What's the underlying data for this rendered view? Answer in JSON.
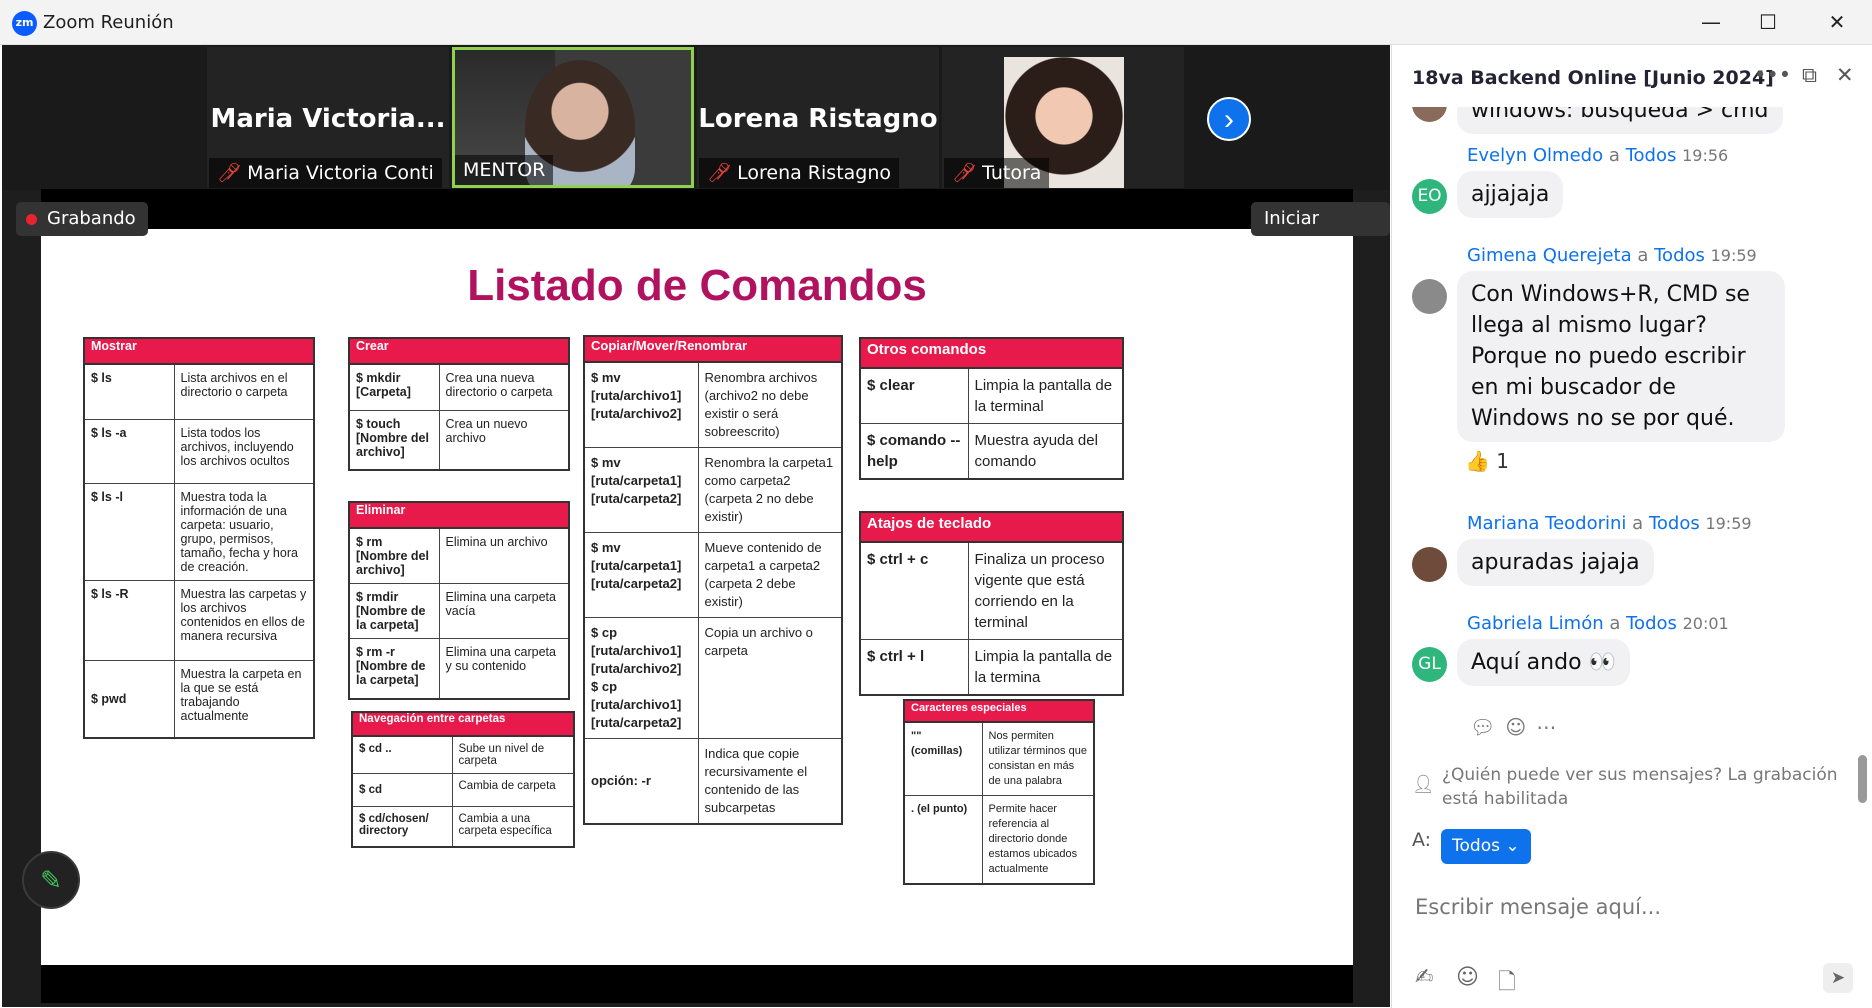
{
  "window": {
    "title": "Zoom Reunión",
    "minimize": "—",
    "maximize": "☐",
    "close": "✕",
    "logo": "zm"
  },
  "participants": [
    {
      "display": "Maria  Victoria...",
      "label": "Maria Victoria Conti",
      "muted": true
    },
    {
      "display": "",
      "label": "MENTOR",
      "muted": false,
      "active_speaker": true
    },
    {
      "display": "Lorena Ristagno",
      "label": "Lorena Ristagno",
      "muted": true
    },
    {
      "display": "",
      "label": "Tutora",
      "muted": true
    }
  ],
  "next_participants_icon": "chevron-right-icon",
  "recording": {
    "label": "Grabando"
  },
  "signin": {
    "label": "Iniciar sesión"
  },
  "slide": {
    "title": "Listado de Comandos",
    "tables": {
      "mostrar": {
        "header": "Mostrar",
        "rows": [
          {
            "cmd": "$ ls",
            "desc": "Lista archivos en el directorio o carpeta"
          },
          {
            "cmd": "$ ls -a",
            "desc": "Lista todos los archivos, incluyendo los archivos ocultos"
          },
          {
            "cmd": "$ ls -l",
            "desc": "Muestra toda la información de una carpeta: usuario, grupo, permisos, tamaño, fecha y hora de creación."
          },
          {
            "cmd": "$ ls -R",
            "desc": "Muestra las carpetas y los archivos contenidos en ellos de manera recursiva"
          },
          {
            "cmd": "$ pwd",
            "desc": "Muestra la carpeta en la que se está trabajando actualmente"
          }
        ]
      },
      "crear": {
        "header": "Crear",
        "rows": [
          {
            "cmd": "$ mkdir [Carpeta]",
            "desc": "Crea una nueva directorio o carpeta"
          },
          {
            "cmd": "$ touch [Nombre del archivo]",
            "desc": "Crea un nuevo archivo"
          }
        ]
      },
      "eliminar": {
        "header": "Eliminar",
        "rows": [
          {
            "cmd": "$ rm [Nombre del archivo]",
            "desc": "Elimina un archivo"
          },
          {
            "cmd": "$ rmdir [Nombre de la carpeta]",
            "desc": "Elimina una carpeta vacía"
          },
          {
            "cmd": "$ rm -r [Nombre de la carpeta]",
            "desc": "Elimina una carpeta y su contenido"
          }
        ]
      },
      "navegacion": {
        "header": "Navegación entre carpetas",
        "rows": [
          {
            "cmd": "$ cd ..",
            "desc": "Sube un nivel de carpeta"
          },
          {
            "cmd": "$ cd",
            "desc": "Cambia de carpeta"
          },
          {
            "cmd": "$ cd/chosen/ directory",
            "desc": "Cambia a una carpeta específica"
          }
        ]
      },
      "copiar": {
        "header": "Copiar/Mover/Renombrar",
        "rows": [
          {
            "cmd": "$ mv [ruta/archivo1] [ruta/archivo2]",
            "desc": "Renombra archivos (archivo2 no debe existir o será sobreescrito)"
          },
          {
            "cmd": "$ mv [ruta/carpeta1] [ruta/carpeta2]",
            "desc": "Renombra la carpeta1 como carpeta2 (carpeta 2 no debe existir)"
          },
          {
            "cmd": "$ mv [ruta/carpeta1] [ruta/carpeta2]",
            "desc": "Mueve contenido de carpeta1 a carpeta2 (carpeta 2 debe existir)"
          },
          {
            "cmd": "$ cp [ruta/archivo1] [ruta/archivo2] $ cp [ruta/archivo1] [ruta/carpeta2]",
            "desc": "Copia un archivo o carpeta"
          },
          {
            "cmd": "opción: -r",
            "desc": "Indica que copie recursivamente el contenido de las subcarpetas"
          }
        ]
      },
      "otros": {
        "header": "Otros comandos",
        "rows": [
          {
            "cmd": "$ clear",
            "desc": "Limpia la pantalla de la terminal"
          },
          {
            "cmd": "$ comando --help",
            "desc": "Muestra ayuda del comando"
          }
        ]
      },
      "atajos": {
        "header": "Atajos de teclado",
        "rows": [
          {
            "cmd": "$ ctrl + c",
            "desc": "Finaliza un proceso vigente que está corriendo en la terminal"
          },
          {
            "cmd": "$ ctrl + l",
            "desc": "Limpia la pantalla de la termina"
          }
        ]
      },
      "especiales": {
        "header": "Caracteres especiales",
        "rows": [
          {
            "cmd": "\"\" (comillas)",
            "desc": "Nos permiten utilizar términos que consistan en más de una palabra"
          },
          {
            "cmd": ". (el punto)",
            "desc": "Permite hacer referencia al directorio donde estamos ubicados actualmente"
          }
        ]
      }
    }
  },
  "chat": {
    "title": "18va Backend Online [Junio 2024]",
    "messages": [
      {
        "cont": true,
        "text": "windows: búsqueda > cmd"
      },
      {
        "initials": "EO",
        "color": "#2eb67d",
        "name": "Evelyn Olmedo",
        "to": "a",
        "recipient": "Todos",
        "time": "19:56",
        "text": "ajjajaja"
      },
      {
        "initials": "",
        "color": "#8a8a8a",
        "name": "Gimena Querejeta",
        "to": "a",
        "recipient": "Todos",
        "time": "19:59",
        "text": "Con Windows+R, CMD se llega al mismo lugar? Porque no puedo escribir en mi buscador de Windows no se por qué.",
        "reaction": "👍",
        "reaction_count": "1"
      },
      {
        "initials": "",
        "color": "#6e4b3a",
        "name": "Mariana Teodorini",
        "to": "a",
        "recipient": "Todos",
        "time": "19:59",
        "text": "apuradas jajaja"
      },
      {
        "initials": "GL",
        "color": "#2eb67d",
        "name": "Gabriela Limón",
        "to": "a",
        "recipient": "Todos",
        "time": "20:01",
        "text": "Aquí ando 👀"
      }
    ],
    "notice": "¿Quién puede ver sus mensajes? La grabación está habilitada",
    "to_label": "A:",
    "to_value": "Todos",
    "input_placeholder": "Escribir mensaje aquí..."
  }
}
